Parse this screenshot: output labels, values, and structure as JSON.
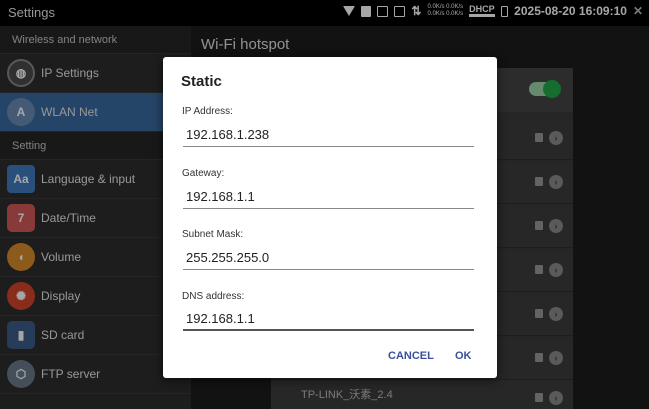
{
  "statusbar": {
    "title": "Settings",
    "speed_up": "0.0K/s 0.0K/s",
    "speed_down": "0.0K/s 0.0K/s",
    "dhcp": "DHCP",
    "datetime": "2025-08-20 16:09:10",
    "close": "✕"
  },
  "sidebar": {
    "section_wireless": "Wireless and network",
    "section_setting": "Setting",
    "items": [
      {
        "label": "IP Settings",
        "icon": "globe-icon",
        "glyph": "◍"
      },
      {
        "label": "WLAN Net",
        "icon": "wlan-icon",
        "glyph": "A"
      },
      {
        "label": "Language & input",
        "icon": "language-icon",
        "glyph": "Aa"
      },
      {
        "label": "Date/Time",
        "icon": "calendar-icon",
        "glyph": "7"
      },
      {
        "label": "Volume",
        "icon": "volume-icon",
        "glyph": "◖"
      },
      {
        "label": "Display",
        "icon": "display-icon",
        "glyph": "✺"
      },
      {
        "label": "SD card",
        "icon": "sd-card-icon",
        "glyph": "▮"
      },
      {
        "label": "FTP server",
        "icon": "ftp-icon",
        "glyph": "⬡"
      }
    ]
  },
  "main": {
    "title": "Wi-Fi hotspot",
    "last_network_name": "TP-LINK_沃素_2.4"
  },
  "dialog": {
    "title": "Static",
    "ip_label": "IP Address:",
    "ip_value": "192.168.1.238",
    "gateway_label": "Gateway:",
    "gateway_value": "192.168.1.1",
    "mask_label": "Subnet Mask:",
    "mask_value": "255.255.255.0",
    "dns_label": "DNS address:",
    "dns_value": "192.168.1.1",
    "cancel_label": "CANCEL",
    "ok_label": "OK"
  },
  "colors": {
    "active_item": "#3a6aa0",
    "toggle_on": "#21a84a",
    "dialog_button": "#3a4f9a"
  }
}
